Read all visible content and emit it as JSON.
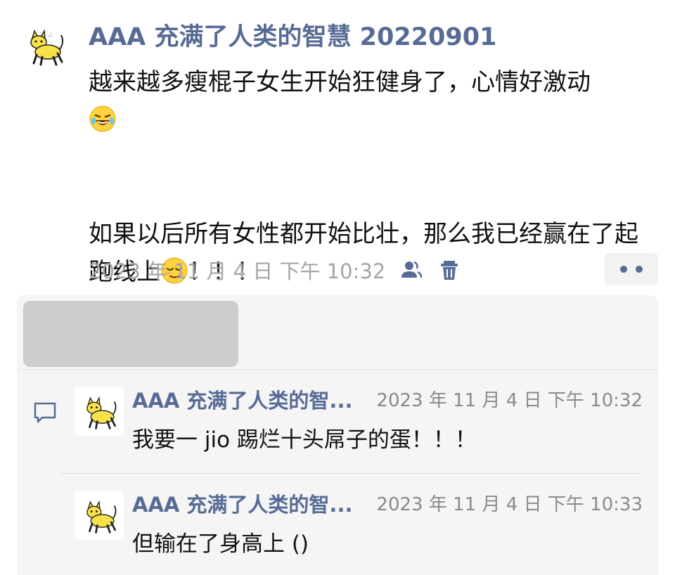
{
  "post": {
    "author": "AAA 充满了人类的智慧 20220901",
    "text_line1": "越来越多瘦棍子女生开始狂健身了，心情好激动",
    "text_line2": "如果以后所有女性都开始比壮，那么我已经赢在了起跑线上",
    "text_tail": "！！！",
    "emoji_1": "laughing-tears-emoji",
    "emoji_2": "relieved-face-emoji",
    "timestamp": "2023 年 11 月 4 日 下午 10:32",
    "icons": [
      "friends-visibility-icon",
      "delete-icon",
      "more-options-icon"
    ]
  },
  "comments": [
    {
      "author": "AAA 充满了人类的智...",
      "time": "2023 年 11 月 4 日 下午 10:32",
      "text": "我要一 jio 踢烂十头屌子的蛋！！！"
    },
    {
      "author": "AAA 充满了人类的智...",
      "time": "2023 年 11 月 4 日 下午 10:33",
      "text": "但输在了身高上 ()"
    }
  ],
  "colors": {
    "link": "#576b95",
    "muted": "#a5a5a5",
    "panel": "#f5f5f5"
  }
}
